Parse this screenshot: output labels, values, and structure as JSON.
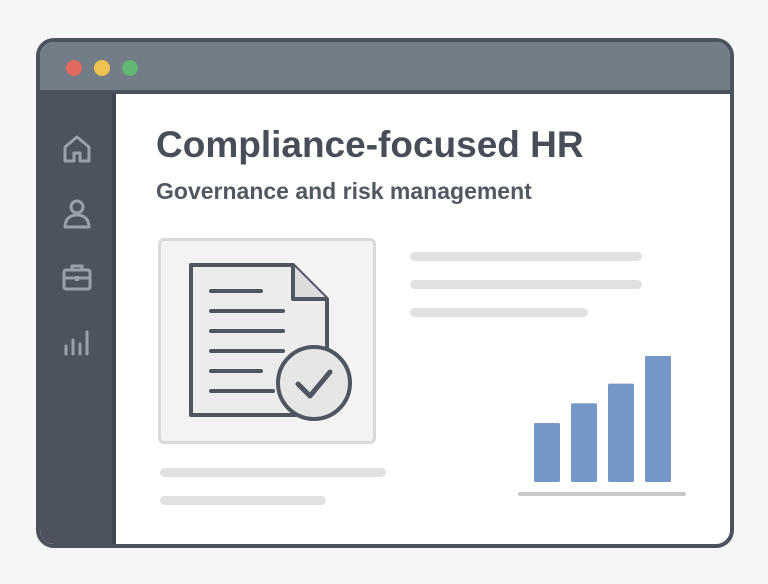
{
  "window": {
    "controls": [
      "close",
      "minimize",
      "maximize"
    ],
    "colors": {
      "close": "#e2695e",
      "minimize": "#eec253",
      "maximize": "#62b673",
      "titlebar": "#737d87",
      "sidebar": "#4d535e"
    }
  },
  "sidebar": {
    "items": [
      {
        "name": "home",
        "icon": "home-icon"
      },
      {
        "name": "users",
        "icon": "user-icon"
      },
      {
        "name": "jobs",
        "icon": "briefcase-icon"
      },
      {
        "name": "analytics",
        "icon": "bar-chart-icon"
      }
    ]
  },
  "main": {
    "title": "Compliance-focused HR",
    "subtitle": "Governance and risk management",
    "document_card": {
      "icons": [
        "document-icon",
        "checkmark-circle-icon"
      ]
    }
  },
  "chart_data": {
    "type": "bar",
    "values": [
      3,
      4,
      5,
      6.4
    ],
    "color": "#7597c7"
  }
}
